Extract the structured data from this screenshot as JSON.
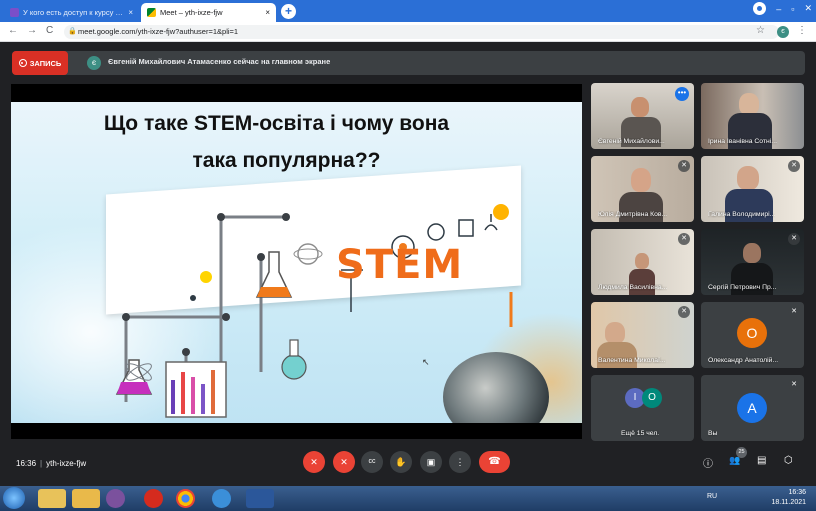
{
  "browser": {
    "tabs": [
      {
        "title": "У кого есть доступ к курсу \"Ма",
        "close": "×"
      },
      {
        "title": "Meet – yth-ixze-fjw",
        "close": "×"
      }
    ],
    "new_tab": "+",
    "url": "meet.google.com/yth-ixze-fjw?authuser=1&pli=1",
    "profile_initial": "є",
    "window_controls": {
      "minimize": "–",
      "maximize": "▫",
      "close": "✕"
    },
    "nav": {
      "back": "←",
      "forward": "→",
      "reload": "C"
    },
    "bookmark_star": "☆",
    "menu": "⋮"
  },
  "banner": {
    "record_label": "ЗАПИСЬ",
    "presenter_initial": "є",
    "message": "Євгеній Михайлович Атамасенко сейчас на главном экране"
  },
  "slide": {
    "title_line1": "Що таке STEM-освіта і чому вона",
    "title_line2": "така популярна??",
    "logo_text": "STEM"
  },
  "participants": [
    {
      "name": "Євгеній Михайлови...",
      "more": "•••"
    },
    {
      "name": "Ірина Іванівна Сотні..."
    },
    {
      "name": "Юлія Дмитрівна Ков...",
      "mute": "✕"
    },
    {
      "name": "Галина Володимирі...",
      "mute": "✕"
    },
    {
      "name": "Людмила Василівна...",
      "mute": "✕"
    },
    {
      "name": "Сергій Петрович Пр...",
      "mute": "✕"
    },
    {
      "name": "Валентина Миколаї...",
      "mute": "✕"
    },
    {
      "name": "Олександр Анатолій...",
      "initial": "О",
      "mute": "✕"
    },
    {
      "name": "Ещё 15 чел.",
      "initials": [
        "І",
        "О"
      ]
    },
    {
      "name": "Вы",
      "initial": "А",
      "mute": "✕"
    }
  ],
  "bottom": {
    "time": "16:36",
    "meeting_code": "yth-ixze-fjw",
    "participant_count": "25",
    "controls": {
      "mic": "✕",
      "camera": "✕",
      "cc": "cc",
      "hand": "✋",
      "present": "▣",
      "more": "⋮",
      "hangup": "☎"
    },
    "right": {
      "info": "ⓘ",
      "people": "👥",
      "chat": "▤",
      "activities": "⬡"
    }
  },
  "taskbar": {
    "lang": "RU",
    "time": "16:36",
    "date": "18.11.2021"
  },
  "colors": {
    "meet_bg": "#202124",
    "record_red": "#d93025",
    "accent_blue": "#1a73e8",
    "tab_strip": "#2b6fd6"
  }
}
